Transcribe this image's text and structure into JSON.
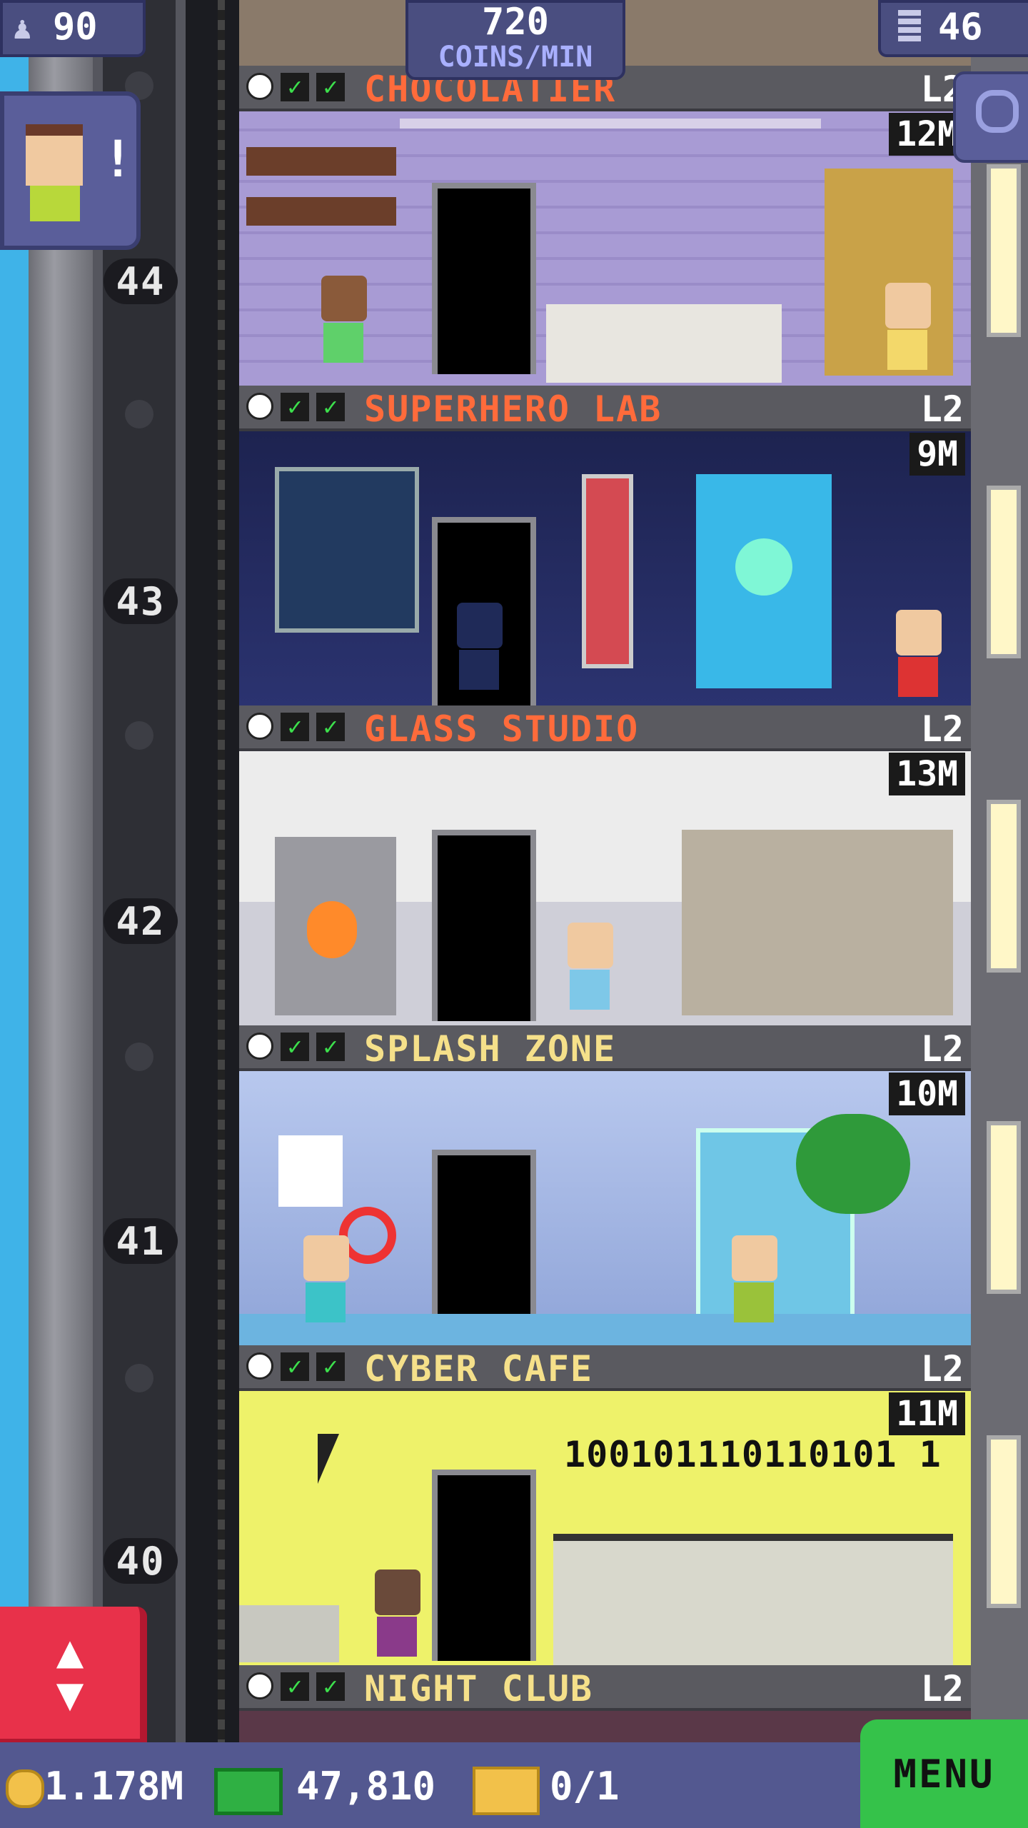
{
  "top_bar": {
    "population": "90",
    "coins_rate_value": "720",
    "coins_rate_label": "COINS/MIN",
    "floors_count": "46"
  },
  "visitor_alert": "!",
  "floor_numbers": [
    "44",
    "43",
    "42",
    "41",
    "40"
  ],
  "floors": [
    {
      "name": "CHOCOLATIER",
      "level": "L2",
      "earnings": "12M",
      "name_color": "#ff6b3b"
    },
    {
      "name": "SUPERHERO LAB",
      "level": "L2",
      "earnings": "9M",
      "name_color": "#ff6b3b"
    },
    {
      "name": "GLASS STUDIO",
      "level": "L2",
      "earnings": "13M",
      "name_color": "#ff6b3b"
    },
    {
      "name": "SPLASH ZONE",
      "level": "L2",
      "earnings": "10M",
      "name_color": "#f5e08a"
    },
    {
      "name": "CYBER CAFE",
      "level": "L2",
      "earnings": "11M",
      "name_color": "#f5e08a"
    },
    {
      "name": "NIGHT CLUB",
      "level": "L2",
      "earnings": "",
      "name_color": "#f5e08a"
    }
  ],
  "cyber_cafe_binary": "100101110110101 1",
  "bottom_bar": {
    "coins": "1.178M",
    "bux": "47,810",
    "tickets": "0/1",
    "menu_label": "MENU"
  },
  "colors": {
    "bottom_bar_bg": "#535890",
    "menu_green": "#35c24a",
    "elevator_button_red": "#e8314a",
    "sky_blue": "#3fb3e8"
  }
}
